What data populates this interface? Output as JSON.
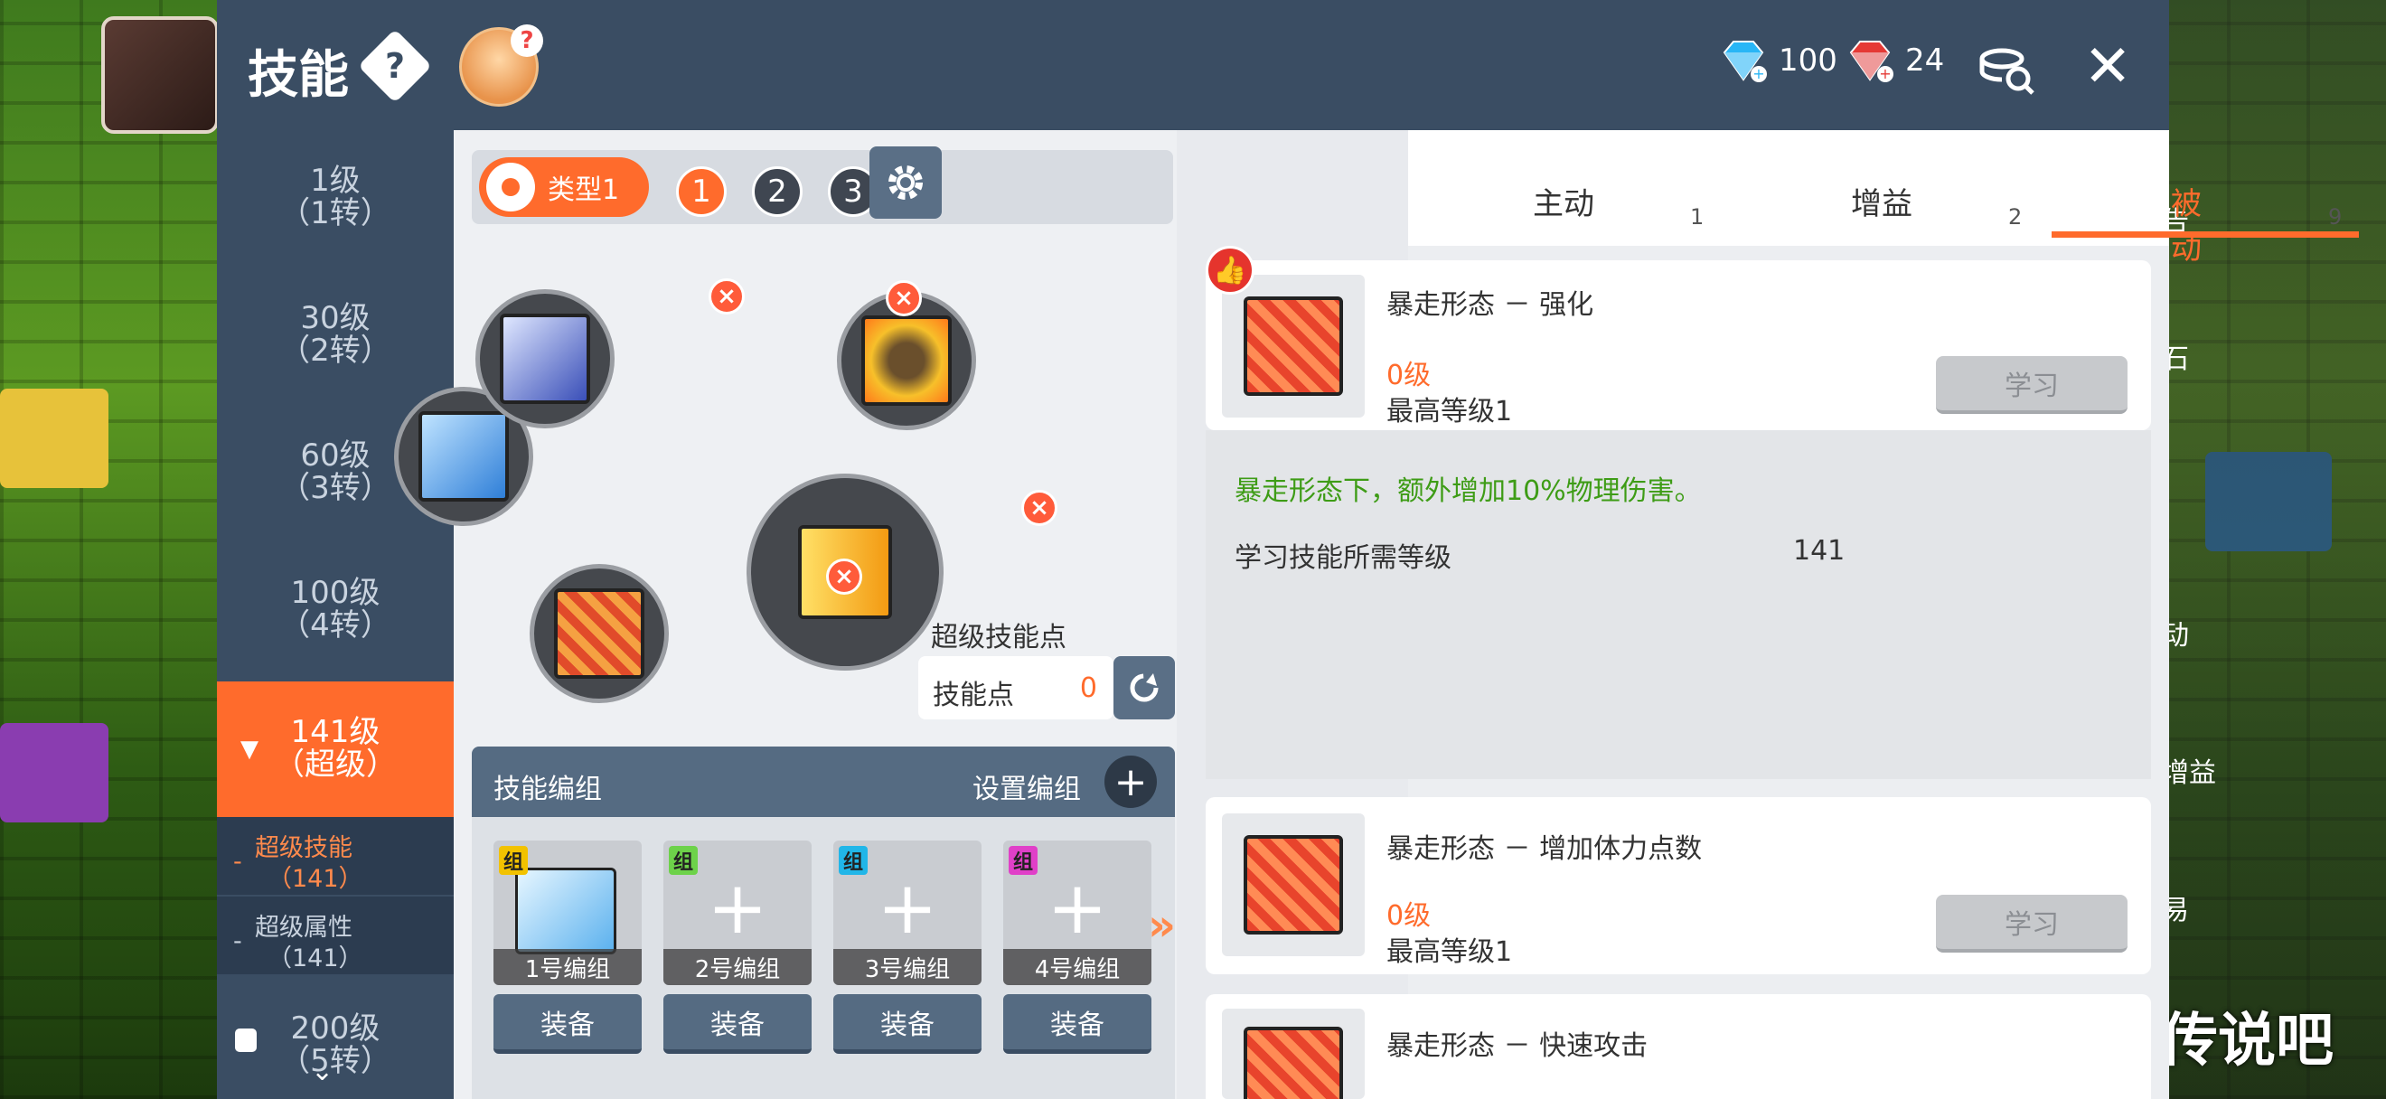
{
  "header": {
    "title": "技能",
    "help_symbol": "?",
    "blue_gem_count": "100",
    "red_gem_count": "24",
    "close_symbol": "✕"
  },
  "sidebar": {
    "levels": [
      {
        "line1": "1级",
        "line2": "（1转）"
      },
      {
        "line1": "30级",
        "line2": "（2转）"
      },
      {
        "line1": "60级",
        "line2": "（3转）"
      },
      {
        "line1": "100级",
        "line2": "（4转）"
      },
      {
        "line1": "141级",
        "line2": "（超级）"
      },
      {
        "line1": "200级",
        "line2": "（5转）"
      }
    ],
    "sub_items": [
      {
        "label": "超级技能",
        "level": "（141）"
      },
      {
        "label": "超级属性",
        "level": "（141）"
      }
    ]
  },
  "preset": {
    "type_label": "类型1",
    "numbers": [
      "1",
      "2",
      "3"
    ]
  },
  "super_points": {
    "title": "超级技能点",
    "label": "技能点",
    "value": "0"
  },
  "groups": {
    "title": "技能编组",
    "setup_label": "设置编组",
    "tag": "组",
    "cards": [
      {
        "caption": "1号编组",
        "equip": "装备",
        "tag_color": "#f2c200"
      },
      {
        "caption": "2号编组",
        "equip": "装备",
        "tag_color": "#6dd24a"
      },
      {
        "caption": "3号编组",
        "equip": "装备",
        "tag_color": "#21b6e8"
      },
      {
        "caption": "4号编组",
        "equip": "装备",
        "tag_color": "#e040c8"
      }
    ]
  },
  "tabs": [
    {
      "label": "主动",
      "count": "1"
    },
    {
      "label": "增益",
      "count": "2"
    },
    {
      "label": "被动",
      "count": "9"
    }
  ],
  "skills": [
    {
      "name": "暴走形态 － 强化",
      "level": "0级",
      "max": "最高等级1",
      "learn": "学习"
    },
    {
      "name": "暴走形态 － 增加体力点数",
      "level": "0级",
      "max": "最高等级1",
      "learn": "学习"
    },
    {
      "name": "暴走形态 － 快速攻击"
    }
  ],
  "detail": {
    "description": "暴走形态下，额外增加10%物理伤害。",
    "req_label": "学习技能所需等级",
    "req_value": "141"
  },
  "background": {
    "right_menu": [
      "告",
      "石",
      "动",
      "增益",
      "易"
    ],
    "watermark": "传说吧"
  },
  "colors": {
    "accent": "#ff6b2c",
    "header": "#3a4d63",
    "desc_green": "#3e9c16"
  }
}
